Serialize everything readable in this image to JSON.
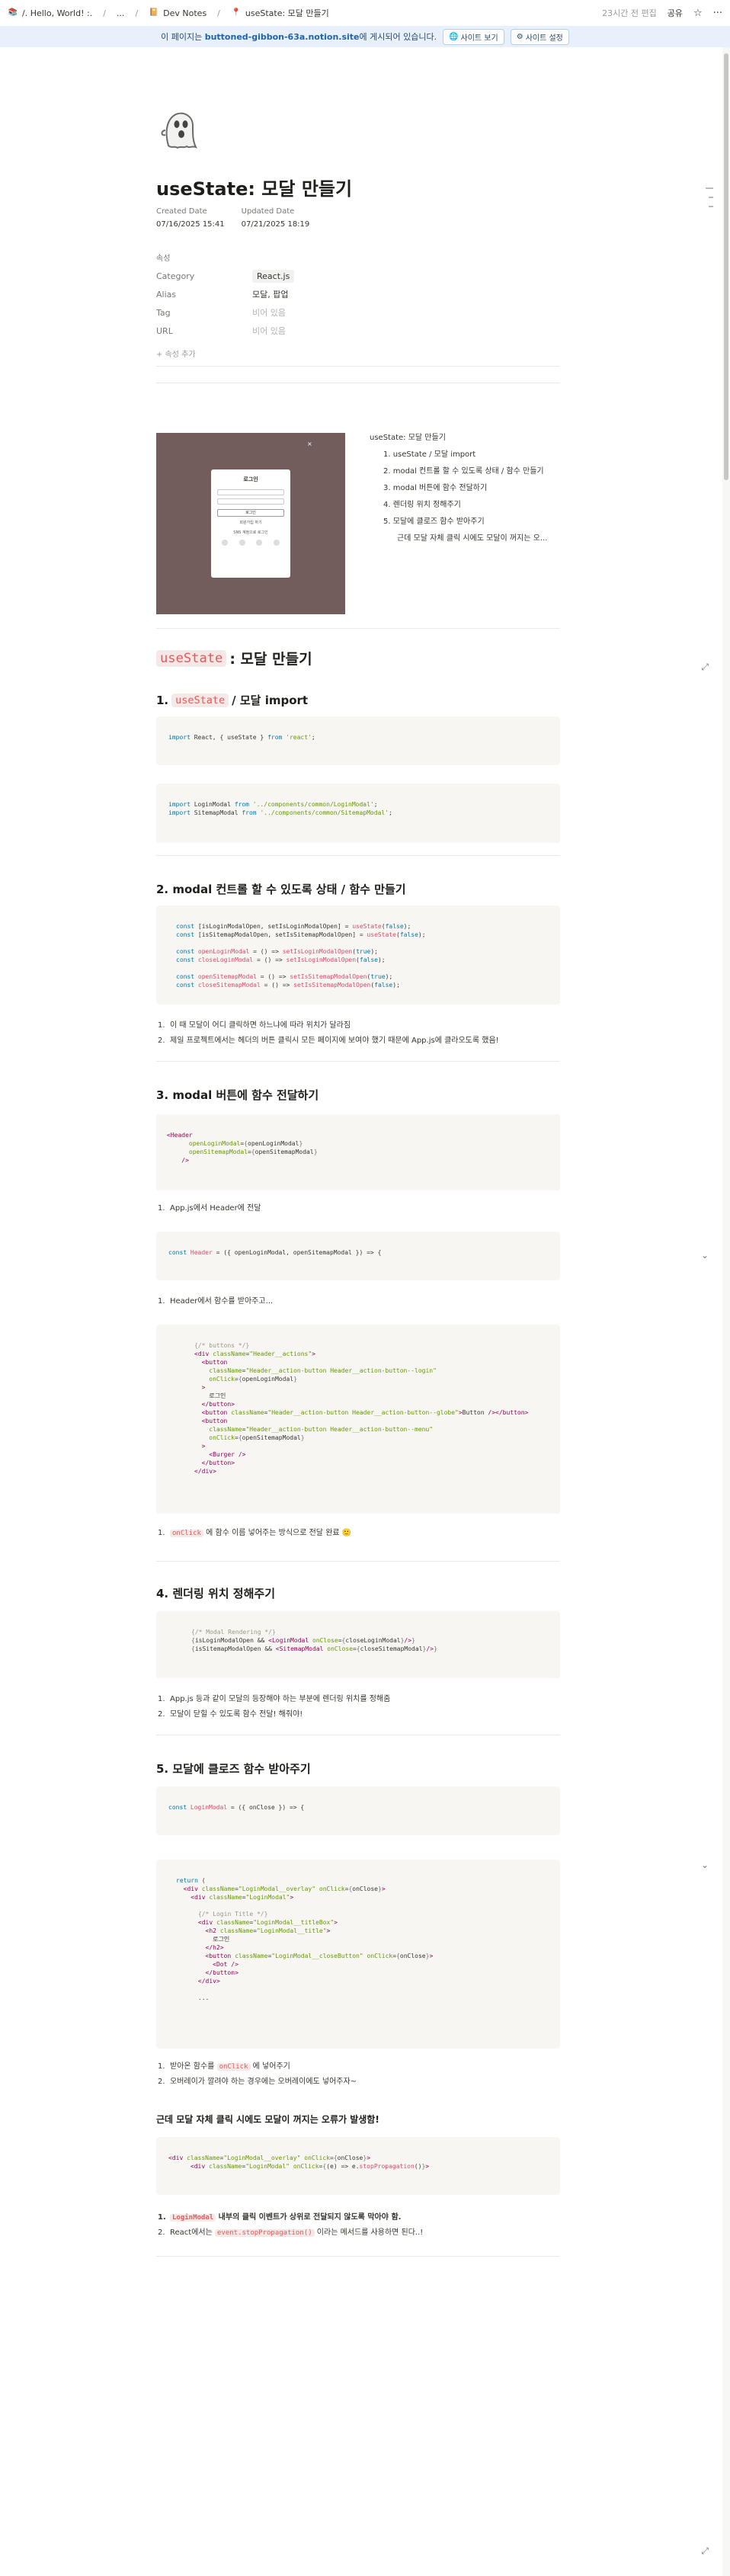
{
  "breadcrumbs": [
    {
      "icon": "📚",
      "label": "/. Hello, World! :."
    },
    {
      "icon": "",
      "label": "..."
    },
    {
      "icon": "📔",
      "label": "Dev Notes"
    },
    {
      "icon": "📍",
      "label": "useState: 모달 만들기"
    }
  ],
  "topbar": {
    "edited": "23시간 전 편집",
    "share": "공유",
    "star_icon": "star-icon",
    "more_icon": "more-icon"
  },
  "banner": {
    "prefix": "이 페이지는 ",
    "domain": "buttoned-gibbon-63a.notion.site",
    "suffix": "에 게시되어 있습니다.",
    "view_site": "사이트 보기",
    "site_settings": "사이트 설정"
  },
  "page": {
    "title": "useState: 모달 만들기",
    "created_label": "Created Date",
    "created_value": "07/16/2025 15:41",
    "updated_label": "Updated Date",
    "updated_value": "07/21/2025 18:19",
    "props_header": "속성",
    "props": [
      {
        "key": "Category",
        "value": "React.js",
        "tag": true
      },
      {
        "key": "Alias",
        "value": "모달, 팝업",
        "tag": false
      },
      {
        "key": "Tag",
        "value": "비어 있음",
        "empty": true
      },
      {
        "key": "URL",
        "value": "비어 있음",
        "empty": true
      }
    ],
    "add_prop": "+ 속성 추가"
  },
  "hero": {
    "modal_title": "로그인",
    "modal_button": "로그인",
    "modal_link": "회원가입 하기",
    "modal_sub": "SNS 계정으로 로그인"
  },
  "toc": [
    "useState: 모달 만들기",
    "1. useState / 모달 import",
    "2. modal 컨트롤 할 수 있도록 상태 / 함수 만들기",
    "3. modal 버튼에 함수 전달하기",
    "4. 렌더링 위치 정해주기",
    "5. 모달에 클로즈 함수 받아주기",
    "근데 모달 자체 클릭 시에도 모달이 꺼지는 오..."
  ],
  "h1": {
    "code": "useState",
    "rest": ": 모달 만들기"
  },
  "s1": {
    "num": "1.",
    "code": "useState",
    "rest": "/ 모달 import",
    "code1": "import React, { useState } from 'react';",
    "code2a": "import LoginModal from '../components/common/LoginModal';",
    "code2b": "import SitemapModal from '../components/common/SitemapModal';"
  },
  "s2": {
    "title": "2. modal 컨트롤 할 수 있도록 상태 / 함수 만들기",
    "list": [
      "이 때 모달이 어디 클릭하면 하느냐에 따라 위치가 달라짐",
      "제일 프로젝트에서는 헤더의 버튼 클릭시 모든 페이지에 보여야 했기 때문에 App.js에 클라오도록 했음!"
    ]
  },
  "s3": {
    "title": "3. modal 버튼에 함수 전달하기",
    "list1": "App.js에서 Header에 전달",
    "list2": "Header에서 함수를 받아주고...",
    "list3_code": "onClick",
    "list3_rest": " 에 함수 이름 넣어주는 방식으로 전달 완료 🙂"
  },
  "s4": {
    "title": "4. 렌더링 위치 정해주기",
    "list": [
      "App.js 등과 같이 모달의 등장해야 하는 부분에 렌더링 위치를 정해줌",
      "모달이 닫힐 수 있도록 함수 전달! 해줘야!"
    ]
  },
  "s5": {
    "title": "5. 모달에 클로즈 함수 받아주기",
    "list1_pre": "받아온 함수를 ",
    "list1_code": "onClick",
    "list1_post": " 에 넣어주기",
    "list2": "오버레이가 깔려야 하는 경우에는 오버레이에도 넣어주자~"
  },
  "s6": {
    "title": "근데 모달 자체 클릭 시에도 모달이 꺼지는 오류가 발생함!",
    "list1_code": "LoginModal",
    "list1_rest": " 내부의 클릭 이벤트가 상위로 전달되지 않도록 막아야 함.",
    "list2_pre": "React에서는 ",
    "list2_code": "event.stopPropagation()",
    "list2_post": " 이라는 메서드를 사용하면 된다..!"
  }
}
